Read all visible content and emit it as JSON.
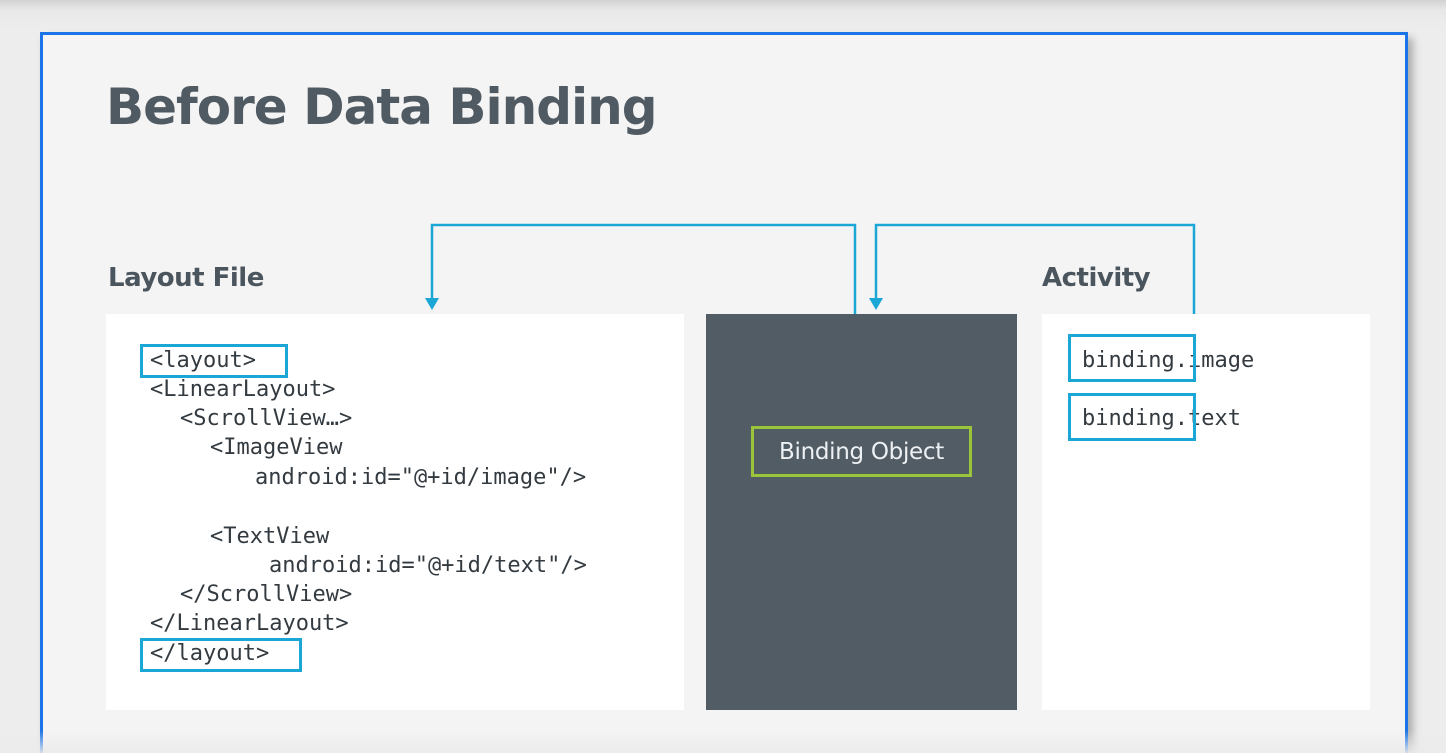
{
  "title": "Before Data Binding",
  "labels": {
    "layout_file": "Layout File",
    "activity": "Activity"
  },
  "layout_code": [
    "<layout>",
    "<LinearLayout>",
    "<ScrollView…>",
    "<ImageView",
    "android:id=\"@+id/image\"/>",
    "<TextView",
    "android:id=\"@+id/text\"/>",
    "</ScrollView>",
    "</LinearLayout>",
    "</layout>"
  ],
  "binding_object_label": "Binding Object",
  "activity_code": [
    {
      "prefix": "binding.",
      "field": "image"
    },
    {
      "prefix": "binding.",
      "field": "text"
    }
  ],
  "colors": {
    "slide_border": "#1a73e8",
    "highlight": "#1aa7d6",
    "binding_object_border": "#9ac43a",
    "binding_panel": "#525c65",
    "title": "#505a63"
  }
}
